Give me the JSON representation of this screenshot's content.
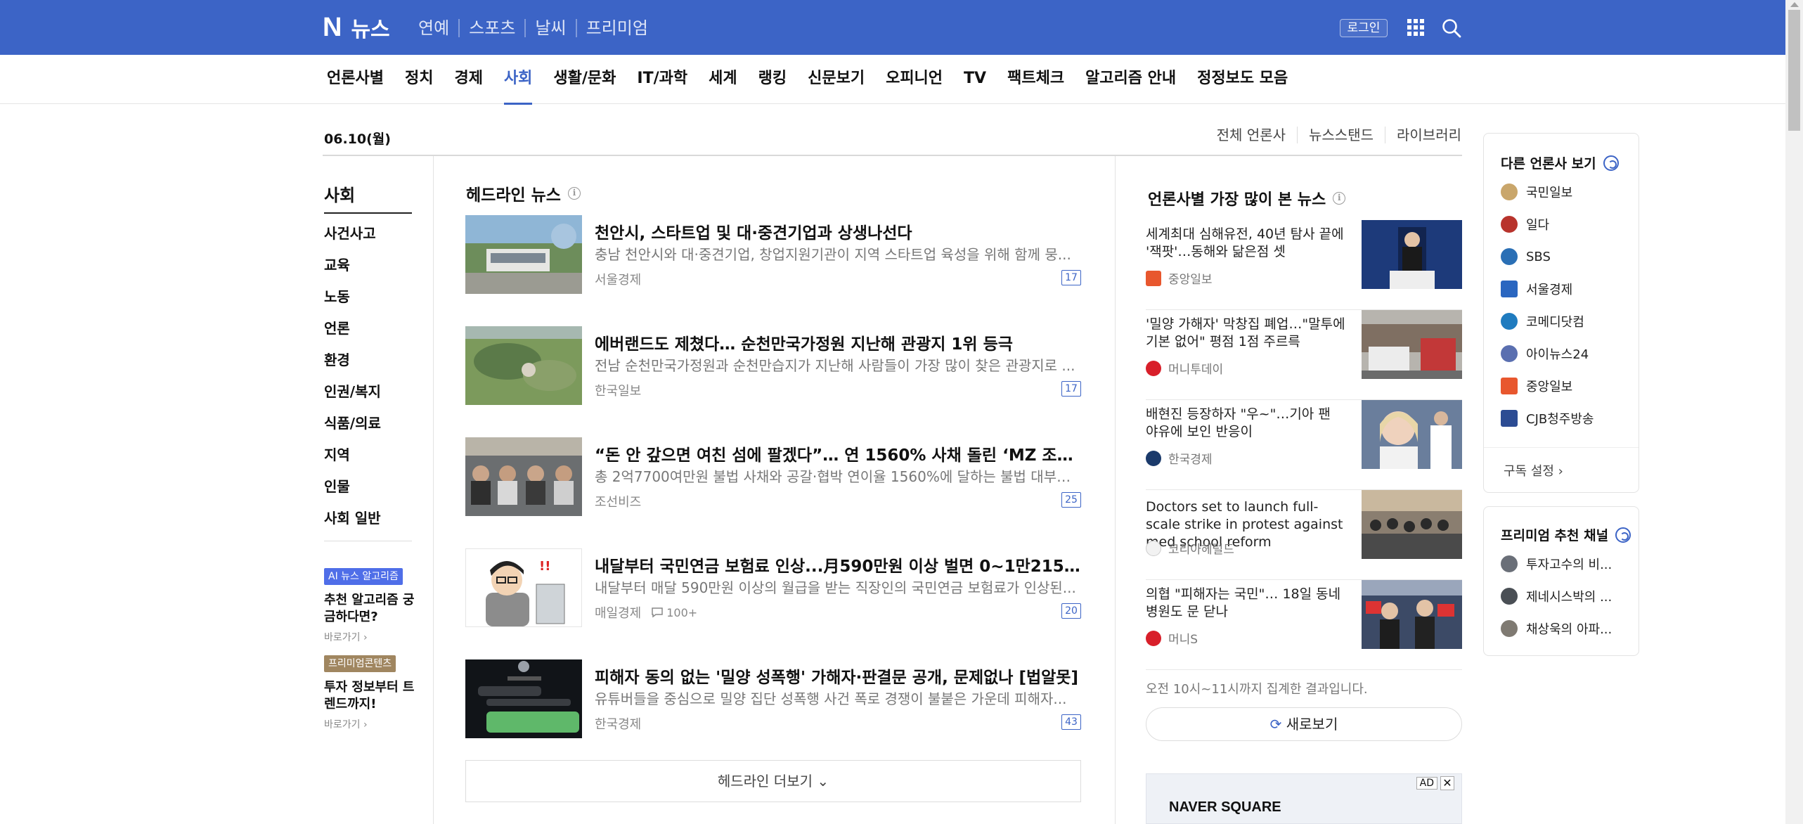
{
  "header": {
    "logo_n": "N",
    "logo_text": "뉴스",
    "top_nav": [
      "연예",
      "스포츠",
      "날씨",
      "프리미엄"
    ],
    "login": "로그인",
    "brand_color": "#3c64c6"
  },
  "category_nav": {
    "items": [
      "언론사별",
      "정치",
      "경제",
      "사회",
      "생활/문화",
      "IT/과학",
      "세계",
      "랭킹",
      "신문보기",
      "오피니언",
      "TV",
      "팩트체크",
      "알고리즘 안내",
      "정정보도 모음"
    ],
    "active": "사회"
  },
  "date": "06.10(월)",
  "right_links": [
    "전체 언론사",
    "뉴스스탠드",
    "라이브러리"
  ],
  "sidebar": {
    "title": "사회",
    "items": [
      "사건사고",
      "교육",
      "노동",
      "언론",
      "환경",
      "인권/복지",
      "식품/의료",
      "지역",
      "인물",
      "사회 일반"
    ],
    "promo1": {
      "badge": "AI 뉴스 알고리즘",
      "text": "추천 알고리즘 궁금하다면?",
      "go": "바로가기 ›"
    },
    "promo2": {
      "badge": "프리미엄콘텐츠",
      "text": "투자 정보부터 트렌드까지!",
      "go": "바로가기 ›"
    }
  },
  "headline": {
    "title": "헤드라인 뉴스",
    "items": [
      {
        "title": "천안시, 스타트업 및 대·중견기업과 상생나선다",
        "desc": "충남 천안시와 대·중견기업, 창업지원기관이 지역 스타트업 육성을 위해 함께 뭉...",
        "source": "서울경제",
        "count": "17"
      },
      {
        "title": "에버랜드도 제쳤다… 순천만국가정원 지난해 관광지 1위 등극",
        "desc": "전남 순천만국가정원과 순천만습지가 지난해 사람들이 가장 많이 찾은 관광지로 ...",
        "source": "한국일보",
        "count": "17"
      },
      {
        "title": "“돈 안 갚으면 여친 섬에 팔겠다”… 연 1560% 사채 돌린 ‘MZ 조폭’, 징역 ...",
        "desc": "총 2억7700여만원 불법 사채와 공갈·협박 연이율 1560%에 달하는 불법 대부업을 ...",
        "source": "조선비즈",
        "count": "25"
      },
      {
        "title": "내달부터 국민연금 보험료 인상...月590만원 이상 벌면 0~1만2150원 올라",
        "desc": "내달부터 매달 590만원 이상의 월급을 받는 직장인의 국민연금 보험료가 인상된...",
        "source": "매일경제",
        "comments": "100+",
        "count": "20"
      },
      {
        "title": "피해자 동의 없는 '밀양 성폭행' 가해자·판결문 공개, 문제없나 [법알못]",
        "desc": "유튜버들을 중심으로 밀양 집단 성폭행 사건 폭로 경쟁이 불붙은 가운데 피해자...",
        "source": "한국경제",
        "count": "43"
      }
    ],
    "more": "헤드라인 더보기"
  },
  "most_viewed": {
    "title": "언론사별 가장 많이 본 뉴스",
    "items": [
      {
        "title": "세계최대 심해유전, 40년 탐사 끝에 '잭팟'…동해와 닮은점 셋",
        "source": "중앙일보",
        "icon_color": "#e8572e"
      },
      {
        "title": "'밀양 가해자' 막창집 폐업…\"말투에 기본 없어\" 평점 1점 주르륵",
        "source": "머니투데이",
        "icon_color": "#d81f2a"
      },
      {
        "title": "배현진 등장하자 \"우~\"…기아 팬 야유에 보인 반응이",
        "source": "한국경제",
        "icon_color": "#1b3a6b"
      },
      {
        "title": "Doctors set to launch full-scale strike in protest against med school reform",
        "source": "코리아헤럴드",
        "icon_color": "#999999"
      },
      {
        "title": "의협 \"피해자는 국민\"… 18일 동네병원도 문 닫나",
        "source": "머니S",
        "icon_color": "#d81f2a"
      }
    ],
    "note": "오전 10시~11시까지 집계한 결과입니다.",
    "refresh": "새로보기",
    "ad_label": "AD",
    "ad_brand": "NAVER SQUARE"
  },
  "rail": {
    "press_title": "다른 언론사 보기",
    "press": [
      {
        "name": "국민일보",
        "color": "#c9a66b"
      },
      {
        "name": "일다",
        "color": "#b8332c"
      },
      {
        "name": "SBS",
        "color": "#2a6fb5"
      },
      {
        "name": "서울경제",
        "color": "#2a66c0"
      },
      {
        "name": "코메디닷컴",
        "color": "#1f7bbf"
      },
      {
        "name": "아이뉴스24",
        "color": "#5a6fb0"
      },
      {
        "name": "중앙일보",
        "color": "#e8572e"
      },
      {
        "name": "CJB청주방송",
        "color": "#2c4c93"
      }
    ],
    "subscribe": "구독 설정 ›",
    "premium_title": "프리미엄 추천 채널",
    "premium": [
      {
        "name": "투자고수의 비...",
        "color": "#6a6f78"
      },
      {
        "name": "제네시스박의 ...",
        "color": "#4a4f55"
      },
      {
        "name": "채상욱의 아파...",
        "color": "#7f7a72"
      }
    ]
  }
}
